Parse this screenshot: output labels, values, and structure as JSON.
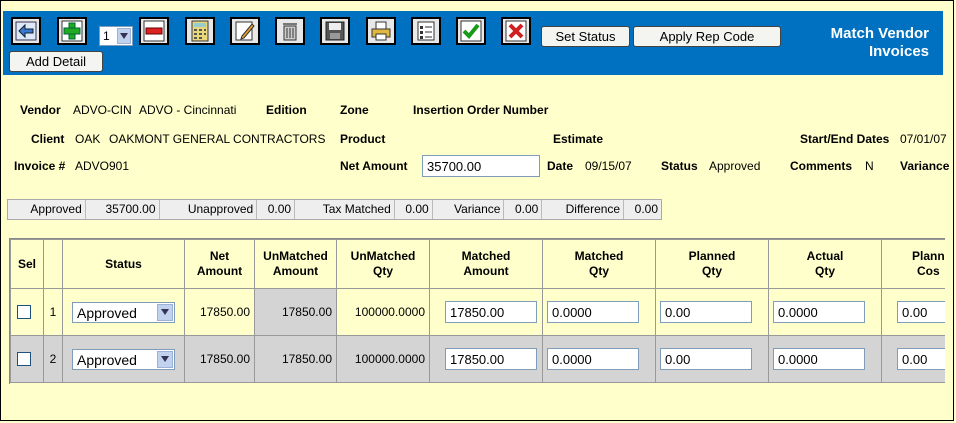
{
  "toolbar": {
    "row_select_value": "1",
    "set_status_label": "Set Status",
    "apply_rep_code_label": "Apply Rep Code",
    "add_detail_label": "Add Detail",
    "title_line1": "Match Vendor",
    "title_line2": "Invoices"
  },
  "header": {
    "vendor_label": "Vendor",
    "vendor_code": "ADVO-CIN",
    "vendor_name": "ADVO - Cincinnati",
    "edition_label": "Edition",
    "zone_label": "Zone",
    "insertion_order_label": "Insertion Order Number",
    "client_label": "Client",
    "client_code": "OAK",
    "client_name": "OAKMONT GENERAL CONTRACTORS",
    "product_label": "Product",
    "estimate_label": "Estimate",
    "start_end_label": "Start/End Dates",
    "start_end_value": "07/01/07",
    "invoice_label": "Invoice #",
    "invoice_value": "ADVO901",
    "net_amount_label": "Net Amount",
    "net_amount_value": "35700.00",
    "date_label": "Date",
    "date_value": "09/15/07",
    "status_label": "Status",
    "status_value": "Approved",
    "comments_label": "Comments",
    "comments_value": "N",
    "variance_label": "Variance"
  },
  "totals": {
    "approved_label": "Approved",
    "approved_value": "35700.00",
    "unapproved_label": "Unapproved",
    "unapproved_value": "0.00",
    "tax_matched_label": "Tax Matched",
    "tax_matched_value": "0.00",
    "variance_label": "Variance",
    "variance_value": "0.00",
    "difference_label": "Difference",
    "difference_value": "0.00"
  },
  "grid": {
    "headers": {
      "sel": "Sel",
      "status": "Status",
      "net_amount_1": "Net",
      "net_amount_2": "Amount",
      "unmatched_amount_1": "UnMatched",
      "unmatched_amount_2": "Amount",
      "unmatched_qty_1": "UnMatched",
      "unmatched_qty_2": "Qty",
      "matched_amount_1": "Matched",
      "matched_amount_2": "Amount",
      "matched_qty_1": "Matched",
      "matched_qty_2": "Qty",
      "planned_qty_1": "Planned",
      "planned_qty_2": "Qty",
      "actual_qty_1": "Actual",
      "actual_qty_2": "Qty",
      "planned_cost_1": "Plann",
      "planned_cost_2": "Cos"
    },
    "rows": [
      {
        "num": "1",
        "status": "Approved",
        "net_amount": "17850.00",
        "unmatched_amount": "17850.00",
        "unmatched_qty": "100000.0000",
        "matched_amount": "17850.00",
        "matched_qty": "0.0000",
        "planned_qty": "0.00",
        "actual_qty": "0.0000",
        "planned_cost": "0.00"
      },
      {
        "num": "2",
        "status": "Approved",
        "net_amount": "17850.00",
        "unmatched_amount": "17850.00",
        "unmatched_qty": "100000.0000",
        "matched_amount": "17850.00",
        "matched_qty": "0.0000",
        "planned_qty": "0.00",
        "actual_qty": "0.0000",
        "planned_cost": "0.00"
      }
    ]
  }
}
